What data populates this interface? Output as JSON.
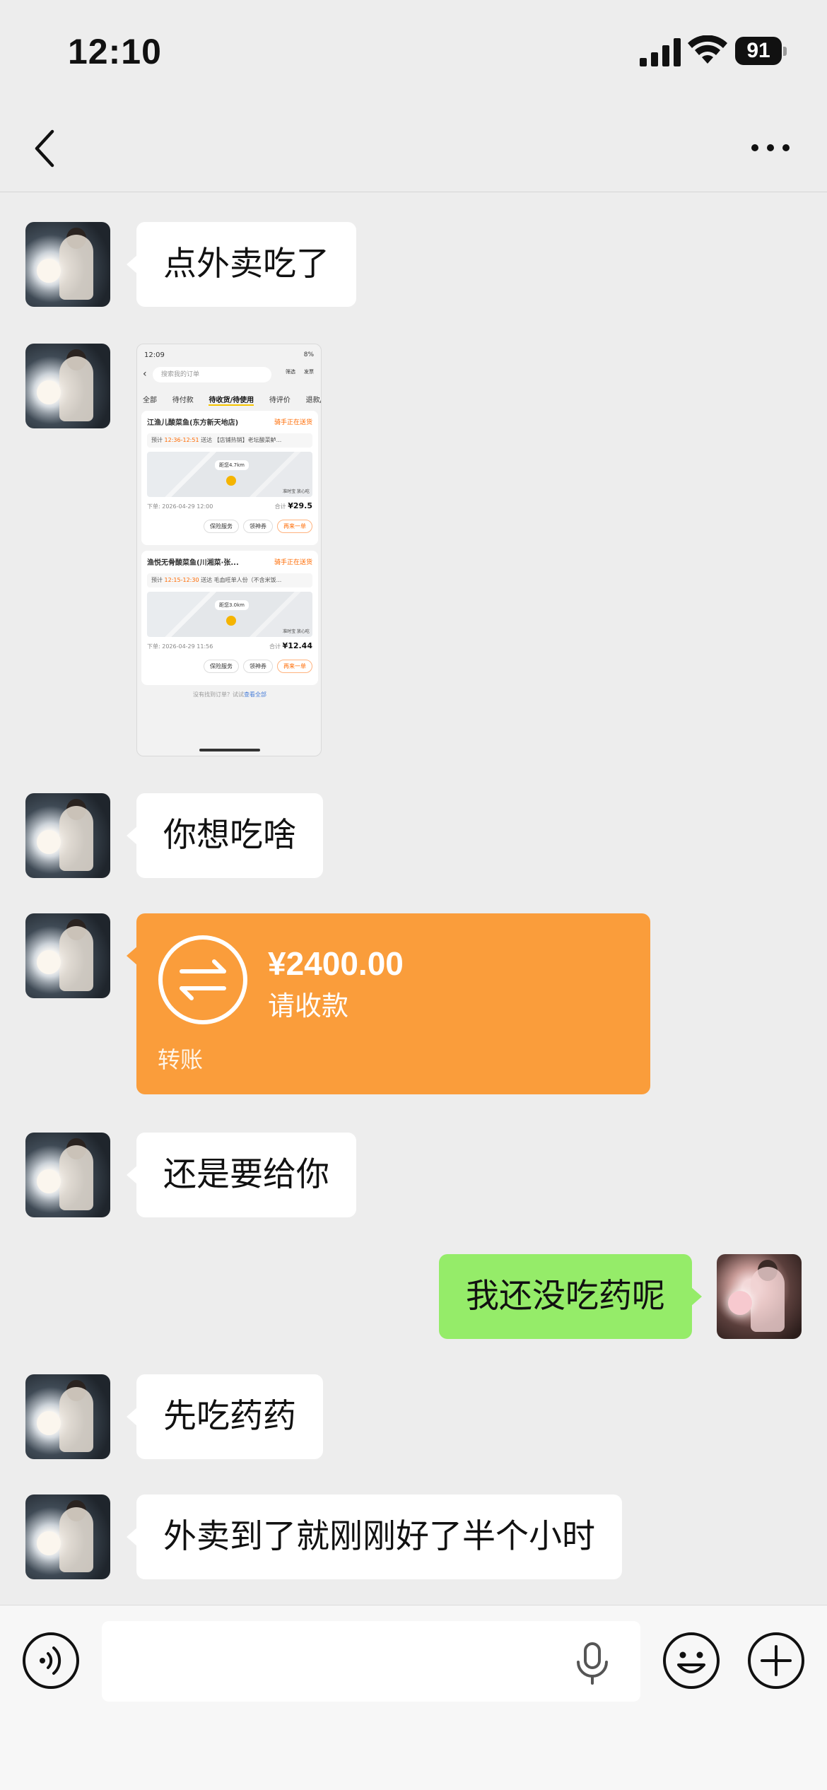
{
  "status_bar": {
    "time": "12:10",
    "battery": "91"
  },
  "nav": {
    "back_icon": "chevron-left-icon",
    "more_icon": "ellipsis-icon"
  },
  "messages": [
    {
      "side": "left",
      "type": "text",
      "text": "点外卖吃了"
    },
    {
      "side": "left",
      "type": "image"
    },
    {
      "side": "left",
      "type": "text",
      "text": "你想吃啥"
    },
    {
      "side": "left",
      "type": "transfer"
    },
    {
      "side": "left",
      "type": "text",
      "text": "还是要给你"
    },
    {
      "side": "right",
      "type": "text",
      "text": "我还没吃药呢"
    },
    {
      "side": "left",
      "type": "text",
      "text": "先吃药药"
    },
    {
      "side": "left",
      "type": "text",
      "text": "外卖到了就刚刚好了半个小时"
    }
  ],
  "transfer": {
    "amount": "¥2400.00",
    "status": "请收款",
    "kind": "转账",
    "color": "#fa9d3b"
  },
  "screenshot": {
    "status_time": "12:09",
    "status_right": "8%",
    "search_placeholder": "搜索我的订单",
    "filter": "筛选",
    "invoice": "发票",
    "tabs": [
      "全部",
      "待付款",
      "待收货/待使用",
      "待评价",
      "退款/"
    ],
    "orders": [
      {
        "shop": "江渔儿酸菜鱼(东方新天地店)",
        "state": "骑手正在送货",
        "eta_prefix": "预计",
        "eta_time": "12:36-12:51",
        "eta_suffix": "送达 【店铺热销】老坛酸菜鲈...",
        "distance": "距您4.7km",
        "tags": "准时宝  放心吃",
        "order_time": "下单: 2026-04-29 12:00",
        "total_label": "合计",
        "total": "¥29.5",
        "buttons": [
          "保险服务",
          "领神券",
          "再来一单"
        ]
      },
      {
        "shop": "渔悦无骨酸菜鱼(川湘菜·张...",
        "state": "骑手正在送货",
        "eta_prefix": "预计",
        "eta_time": "12:15-12:30",
        "eta_suffix": "送达 毛血旺单人份（不含米饭...",
        "distance": "距您3.0km",
        "tags": "准时宝  放心吃",
        "order_time": "下单: 2026-04-29 11:56",
        "total_label": "合计",
        "total": "¥12.44",
        "buttons": [
          "保险服务",
          "领神券",
          "再来一单"
        ]
      }
    ],
    "footer_text": "没有找到订单？试试",
    "footer_link": "查看全部"
  },
  "input_bar": {
    "placeholder": "",
    "voice_icon": "voice-icon",
    "mic_icon": "microphone-icon",
    "emoji_icon": "emoji-icon",
    "plus_icon": "plus-icon"
  }
}
